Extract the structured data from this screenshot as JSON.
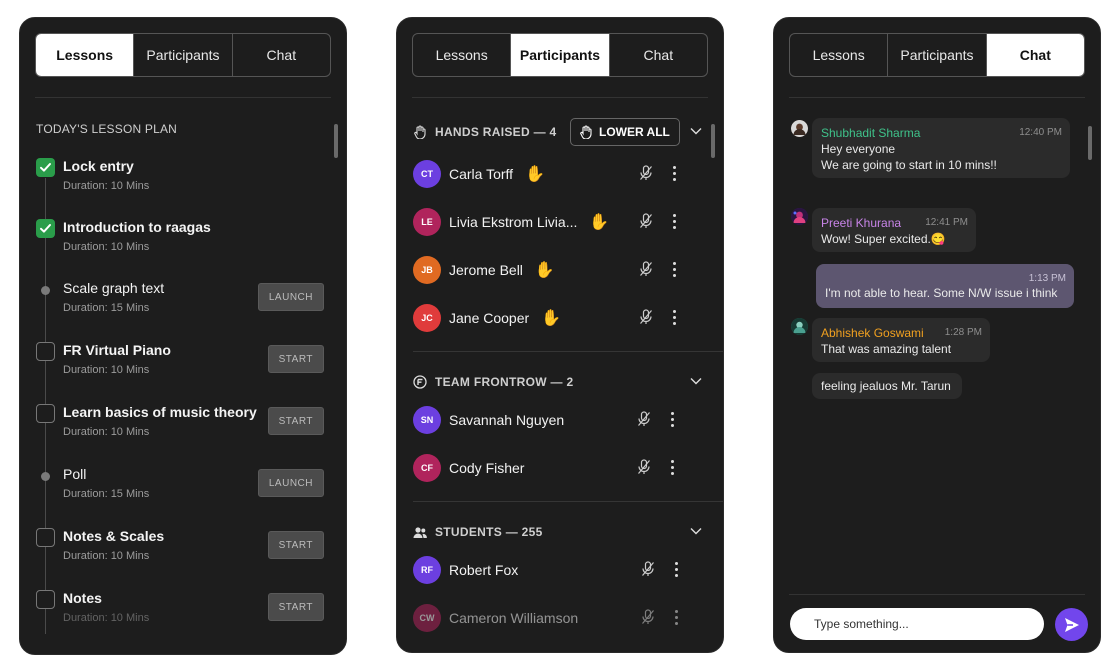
{
  "tabs": {
    "lessons": "Lessons",
    "participants": "Participants",
    "chat": "Chat"
  },
  "lessons_panel": {
    "section_title": "TODAY'S LESSON PLAN",
    "items": [
      {
        "title": "Lock entry",
        "duration": "Duration: 10 Mins",
        "state": "done",
        "action": ""
      },
      {
        "title": "Introduction to raagas",
        "duration": "Duration: 10 Mins",
        "state": "done",
        "action": ""
      },
      {
        "title": "Scale graph text",
        "duration": "Duration: 15 Mins",
        "state": "dot",
        "action": "LAUNCH"
      },
      {
        "title": "FR Virtual Piano",
        "duration": "Duration: 10 Mins",
        "state": "todo",
        "action": "START"
      },
      {
        "title": "Learn basics of music theory",
        "duration": "Duration: 10 Mins",
        "state": "todo",
        "action": "START"
      },
      {
        "title": "Poll",
        "duration": "Duration: 15 Mins",
        "state": "dot",
        "action": "LAUNCH"
      },
      {
        "title": "Notes & Scales",
        "duration": "Duration: 10 Mins",
        "state": "todo",
        "action": "START"
      },
      {
        "title": "Notes",
        "duration": "Duration: 10 Mins",
        "state": "todo",
        "action": "START"
      }
    ]
  },
  "participants_panel": {
    "hands_raised": {
      "label": "HANDS RAISED — 4",
      "lower_all": "LOWER ALL",
      "people": [
        {
          "initials": "CT",
          "name": "Carla Torff",
          "color": "#6c3fe0"
        },
        {
          "initials": "LE",
          "name": "Livia Ekstrom Livia...",
          "color": "#b0245c"
        },
        {
          "initials": "JB",
          "name": "Jerome Bell",
          "color": "#e06a22"
        },
        {
          "initials": "JC",
          "name": "Jane Cooper",
          "color": "#e03b3b"
        }
      ]
    },
    "team": {
      "label": "TEAM FRONTROW — 2",
      "people": [
        {
          "initials": "SN",
          "name": "Savannah Nguyen",
          "color": "#6c3fe0"
        },
        {
          "initials": "CF",
          "name": "Cody Fisher",
          "color": "#b0245c"
        }
      ]
    },
    "students": {
      "label": "STUDENTS — 255",
      "people": [
        {
          "initials": "RF",
          "name": "Robert Fox",
          "color": "#6c3fe0"
        },
        {
          "initials": "CW",
          "name": "Cameron Williamson",
          "color": "#b0245c"
        }
      ]
    }
  },
  "chat_panel": {
    "messages": [
      {
        "sender": "Shubhadit Sharma",
        "time": "12:40 PM",
        "lines": [
          "Hey everyone",
          "We are going to start in 10 mins!!"
        ],
        "sender_color": "#3fc28a"
      },
      {
        "sender": "Preeti Khurana",
        "time": "12:41 PM",
        "lines": [
          "Wow! Super excited.😋"
        ],
        "sender_color": "#c884e8"
      },
      {
        "sender": "",
        "time": "1:13 PM",
        "lines": [
          "I'm not able to hear. Some N/W issue i think"
        ],
        "sender_color": ""
      },
      {
        "sender": "Abhishek Goswami",
        "time": "1:28 PM",
        "lines": [
          "That was amazing talent"
        ],
        "sender_color": "#f0a020"
      },
      {
        "sender": "",
        "time": "",
        "lines": [
          "feeling jealuos Mr. Tarun"
        ],
        "sender_color": ""
      }
    ],
    "input_placeholder": "Type something..."
  },
  "colors": {
    "panel_bg": "#1d1d1d",
    "done_green": "#2a9d4a",
    "hand_yellow": "#f5b324",
    "send_purple": "#7246ec"
  }
}
